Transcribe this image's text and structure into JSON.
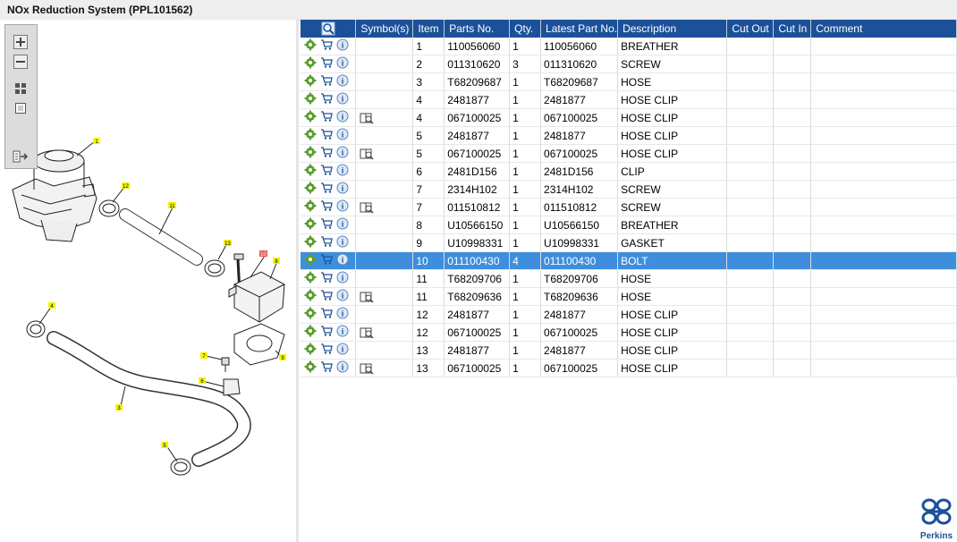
{
  "window": {
    "title": "NOx Reduction System (PPL101562)"
  },
  "zoom_toolbar": {
    "buttons": [
      "zoom-in",
      "zoom-out",
      "fit-all",
      "actual-size",
      "export"
    ]
  },
  "diagram": {
    "callouts": [
      "1",
      "12",
      "11",
      "13",
      "10",
      "8",
      "4",
      "7",
      "6",
      "9",
      "3",
      "5"
    ],
    "highlighted_callout": "10"
  },
  "table": {
    "columns": [
      "",
      "Symbol(s)",
      "Item",
      "Parts No.",
      "Qty.",
      "Latest Part No.",
      "Description",
      "Cut Out",
      "Cut In",
      "Comment"
    ],
    "rows": [
      {
        "symbol": "",
        "item": "1",
        "part": "110056060",
        "qty": "1",
        "latest": "110056060",
        "desc": "BREATHER",
        "cut_out": "",
        "cut_in": "",
        "comment": ""
      },
      {
        "symbol": "",
        "item": "2",
        "part": "011310620",
        "qty": "3",
        "latest": "011310620",
        "desc": "SCREW",
        "cut_out": "",
        "cut_in": "",
        "comment": ""
      },
      {
        "symbol": "",
        "item": "3",
        "part": "T68209687",
        "qty": "1",
        "latest": "T68209687",
        "desc": "HOSE",
        "cut_out": "",
        "cut_in": "",
        "comment": ""
      },
      {
        "symbol": "",
        "item": "4",
        "part": "2481877",
        "qty": "1",
        "latest": "2481877",
        "desc": "HOSE CLIP",
        "cut_out": "",
        "cut_in": "",
        "comment": ""
      },
      {
        "symbol": "book",
        "item": "4",
        "part": "067100025",
        "qty": "1",
        "latest": "067100025",
        "desc": "HOSE CLIP",
        "cut_out": "",
        "cut_in": "",
        "comment": ""
      },
      {
        "symbol": "",
        "item": "5",
        "part": "2481877",
        "qty": "1",
        "latest": "2481877",
        "desc": "HOSE CLIP",
        "cut_out": "",
        "cut_in": "",
        "comment": ""
      },
      {
        "symbol": "book",
        "item": "5",
        "part": "067100025",
        "qty": "1",
        "latest": "067100025",
        "desc": "HOSE CLIP",
        "cut_out": "",
        "cut_in": "",
        "comment": ""
      },
      {
        "symbol": "",
        "item": "6",
        "part": "2481D156",
        "qty": "1",
        "latest": "2481D156",
        "desc": "CLIP",
        "cut_out": "",
        "cut_in": "",
        "comment": ""
      },
      {
        "symbol": "",
        "item": "7",
        "part": "2314H102",
        "qty": "1",
        "latest": "2314H102",
        "desc": "SCREW",
        "cut_out": "",
        "cut_in": "",
        "comment": ""
      },
      {
        "symbol": "book",
        "item": "7",
        "part": "011510812",
        "qty": "1",
        "latest": "011510812",
        "desc": "SCREW",
        "cut_out": "",
        "cut_in": "",
        "comment": ""
      },
      {
        "symbol": "",
        "item": "8",
        "part": "U10566150",
        "qty": "1",
        "latest": "U10566150",
        "desc": "BREATHER",
        "cut_out": "",
        "cut_in": "",
        "comment": ""
      },
      {
        "symbol": "",
        "item": "9",
        "part": "U10998331",
        "qty": "1",
        "latest": "U10998331",
        "desc": "GASKET",
        "cut_out": "",
        "cut_in": "",
        "comment": ""
      },
      {
        "symbol": "",
        "item": "10",
        "part": "011100430",
        "qty": "4",
        "latest": "011100430",
        "desc": "BOLT",
        "cut_out": "",
        "cut_in": "",
        "comment": "",
        "selected": true
      },
      {
        "symbol": "",
        "item": "11",
        "part": "T68209706",
        "qty": "1",
        "latest": "T68209706",
        "desc": "HOSE",
        "cut_out": "",
        "cut_in": "",
        "comment": ""
      },
      {
        "symbol": "book",
        "item": "11",
        "part": "T68209636",
        "qty": "1",
        "latest": "T68209636",
        "desc": "HOSE",
        "cut_out": "",
        "cut_in": "",
        "comment": ""
      },
      {
        "symbol": "",
        "item": "12",
        "part": "2481877",
        "qty": "1",
        "latest": "2481877",
        "desc": "HOSE CLIP",
        "cut_out": "",
        "cut_in": "",
        "comment": ""
      },
      {
        "symbol": "book",
        "item": "12",
        "part": "067100025",
        "qty": "1",
        "latest": "067100025",
        "desc": "HOSE CLIP",
        "cut_out": "",
        "cut_in": "",
        "comment": ""
      },
      {
        "symbol": "",
        "item": "13",
        "part": "2481877",
        "qty": "1",
        "latest": "2481877",
        "desc": "HOSE CLIP",
        "cut_out": "",
        "cut_in": "",
        "comment": ""
      },
      {
        "symbol": "book",
        "item": "13",
        "part": "067100025",
        "qty": "1",
        "latest": "067100025",
        "desc": "HOSE CLIP",
        "cut_out": "",
        "cut_in": "",
        "comment": ""
      }
    ]
  },
  "row_icons": [
    "gear-icon",
    "cart-icon",
    "info-icon"
  ],
  "brand": {
    "name": "Perkins",
    "color": "#1c5199"
  },
  "colors": {
    "header_bg": "#1c5199",
    "selected_row": "#3e8edd",
    "callout_bg": "#f5f500",
    "callout_highlight": "#e85a5a"
  }
}
